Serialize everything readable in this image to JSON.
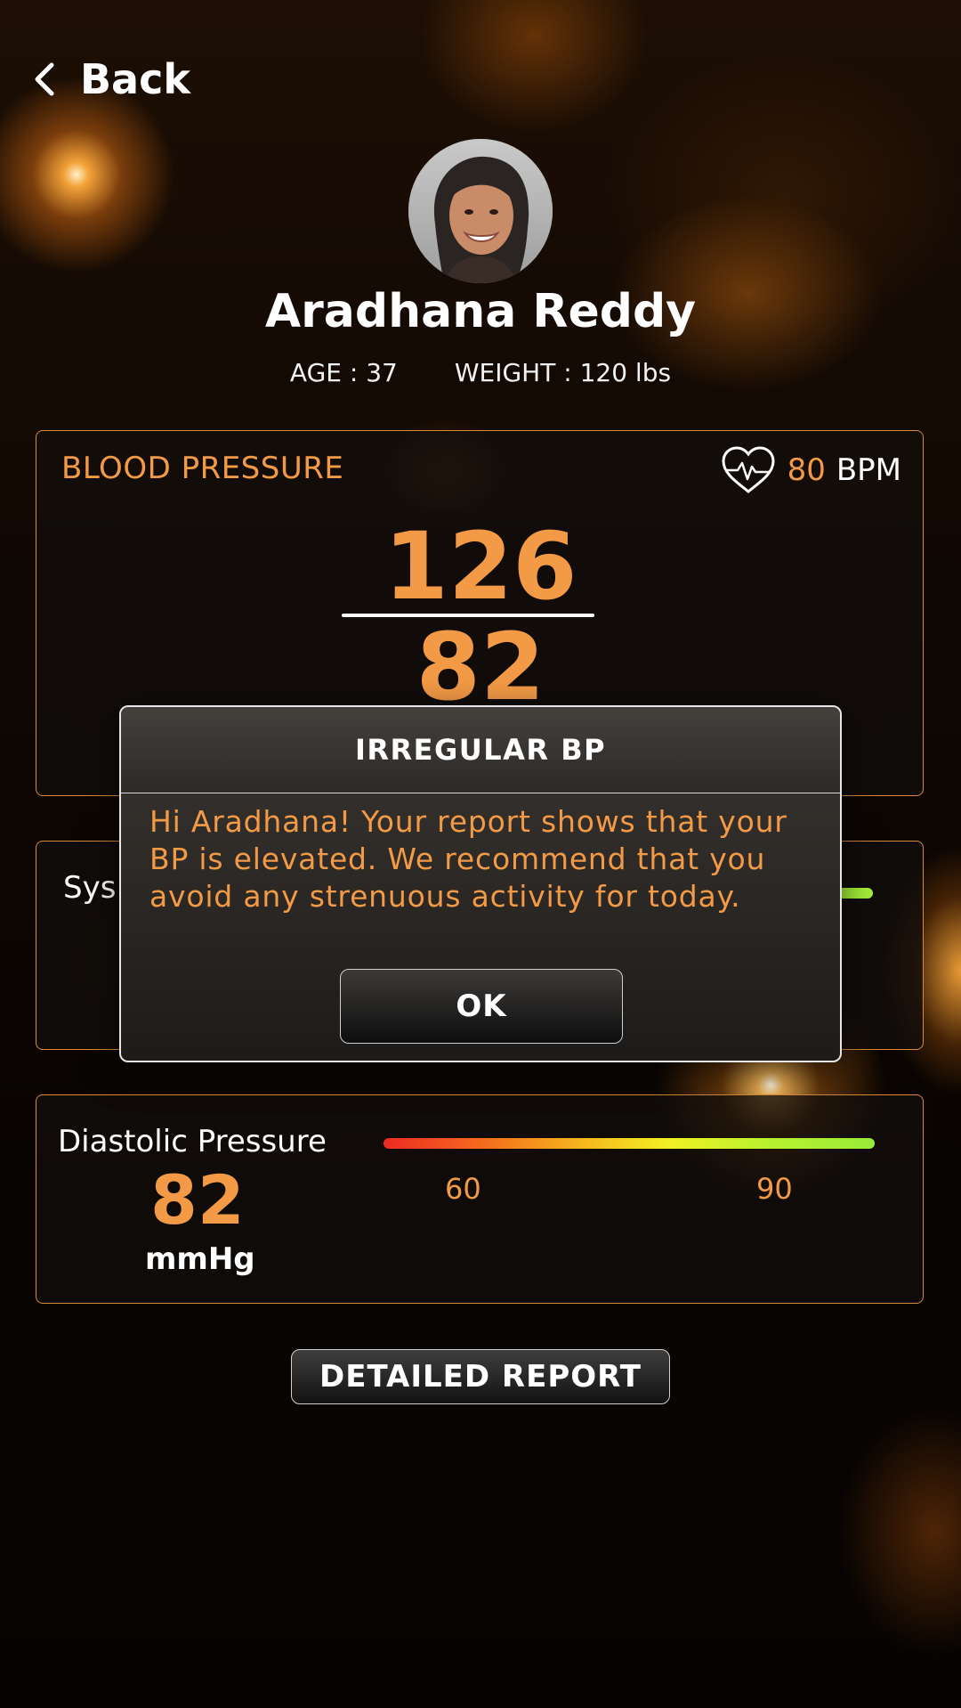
{
  "header": {
    "back_label": "Back"
  },
  "profile": {
    "name": "Aradhana Reddy",
    "age": "AGE : 37",
    "weight": "WEIGHT : 120 lbs"
  },
  "blood_pressure": {
    "title": "BLOOD PRESSURE",
    "bpm_value": "80",
    "bpm_unit": "BPM",
    "systolic": "126",
    "diastolic": "82"
  },
  "systolic_card": {
    "label": "Sys"
  },
  "diastolic_card": {
    "label": "Diastolic Pressure",
    "value": "82",
    "unit": "mmHg",
    "scale_low": "60",
    "scale_high": "90"
  },
  "actions": {
    "detailed_report_label": "DETAILED REPORT"
  },
  "modal": {
    "title": "IRREGULAR BP",
    "message": "Hi Aradhana! Your report shows that your BP is elevated. We recommend that you avoid any strenuous activity for today.",
    "ok_label": "OK"
  },
  "colors": {
    "accent": "#f29a46",
    "card_border": "#d98a3a",
    "bar_red": "#ee2a22",
    "bar_yellow": "#f2f024",
    "bar_green": "#98ea3a"
  },
  "icons": {
    "back": "chevron-left-icon",
    "heart_rate": "heart-pulse-icon"
  }
}
